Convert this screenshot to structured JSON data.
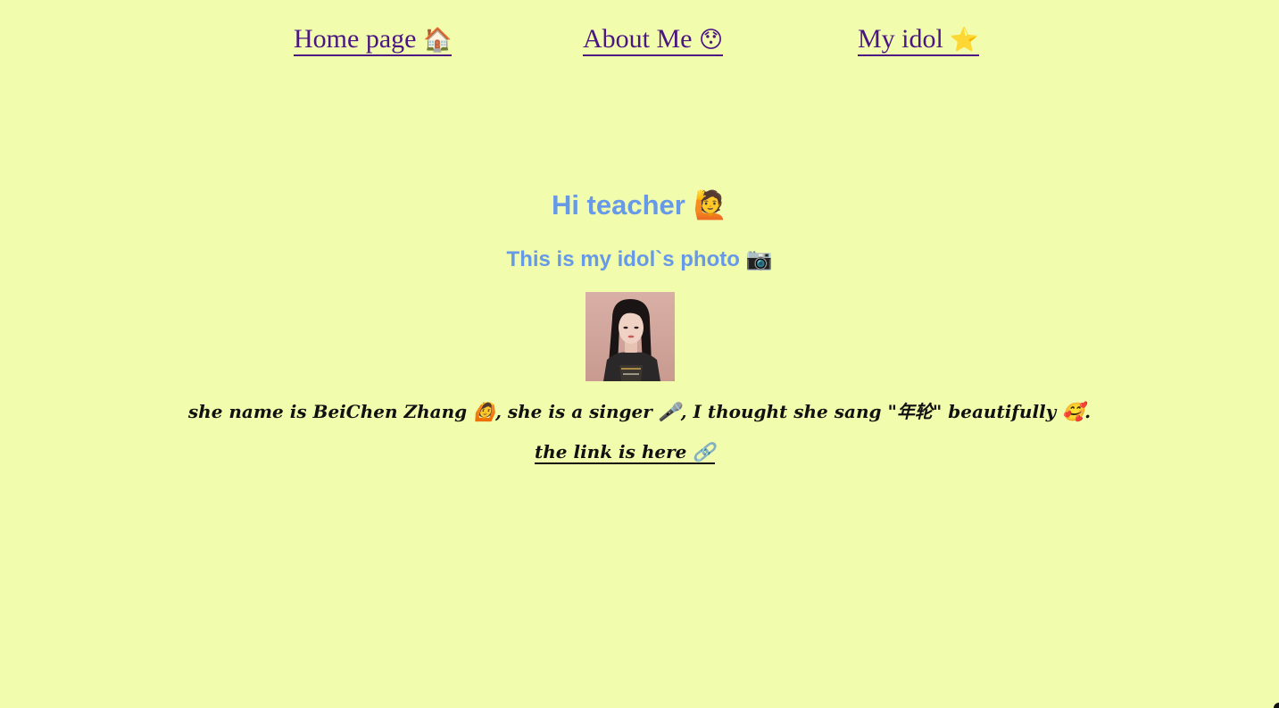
{
  "nav": {
    "items": [
      {
        "label": "Home page",
        "emoji": "🏠"
      },
      {
        "label": "About Me",
        "emoji": "😯"
      },
      {
        "label": "My idol",
        "emoji": "⭐"
      }
    ]
  },
  "main": {
    "title": "Hi teacher 🙋",
    "subtitle": "This is my idol`s photo 📷",
    "description": "she name is BeiChen Zhang 🙆, she is a singer 🎤,  I thought she sang \"年轮\" beautifully 🥰.",
    "link_label": "the link is here 🔗"
  },
  "colors": {
    "background": "#f1fcac",
    "nav_link": "#4b1682",
    "heading": "#6699e8",
    "body_text": "#111111"
  }
}
